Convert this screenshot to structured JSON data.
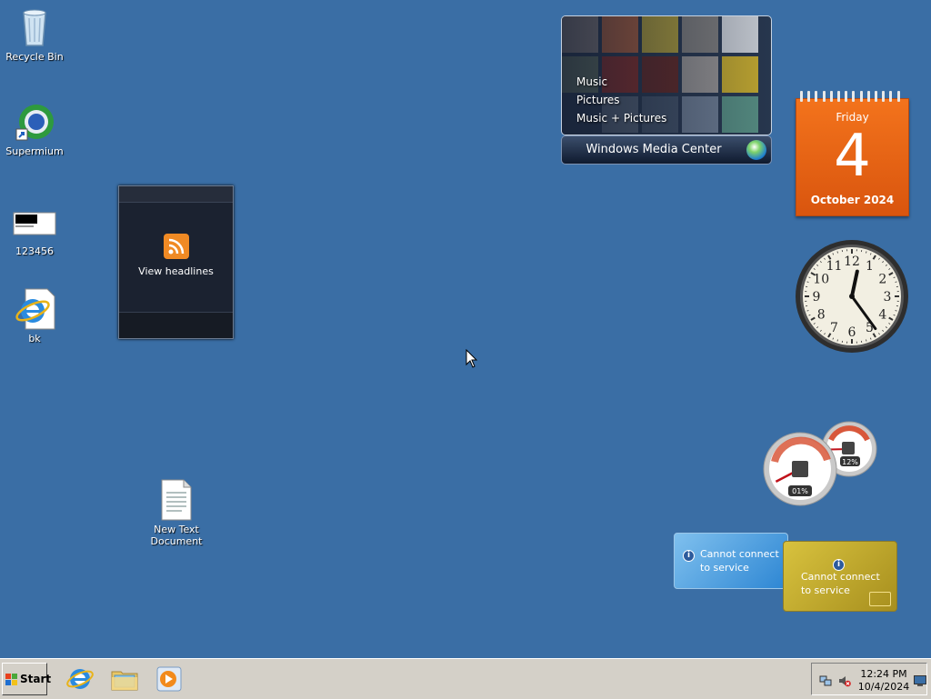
{
  "desktop": {
    "icons": [
      {
        "label": "Recycle Bin"
      },
      {
        "label": "Supermium"
      },
      {
        "label": "123456"
      },
      {
        "label": "bk"
      },
      {
        "label": "New Text Document"
      }
    ]
  },
  "gadgets": {
    "feed": {
      "label": "View headlines"
    },
    "media_center": {
      "menu": [
        "Music",
        "Pictures",
        "Music + Pictures"
      ],
      "title": "Windows Media Center"
    },
    "calendar": {
      "weekday": "Friday",
      "day": "4",
      "month_year": "October 2024"
    },
    "clock": {
      "numerals": [
        "12",
        "1",
        "2",
        "3",
        "4",
        "5",
        "6",
        "7",
        "8",
        "9",
        "10",
        "11"
      ],
      "time": "12:24"
    },
    "cpu_meter": {
      "cpu": "01%",
      "memory": "12%",
      "cpu_value": 1,
      "memory_value": 12
    },
    "weather": {
      "message": "Cannot connect to service"
    },
    "stocks": {
      "message": "Cannot connect to service"
    }
  },
  "taskbar": {
    "start_label": "Start",
    "quick_launch": [
      "internet-explorer-icon",
      "folder-icon",
      "media-player-icon"
    ],
    "clock_time": "12:24 PM",
    "clock_date": "10/4/2024"
  },
  "colors": {
    "desktop": "#3a6ea5",
    "taskbar": "#d4d0c8",
    "calendar": "#e8651a",
    "weather": "#4fa3e3",
    "stocks": "#c9b02f"
  }
}
